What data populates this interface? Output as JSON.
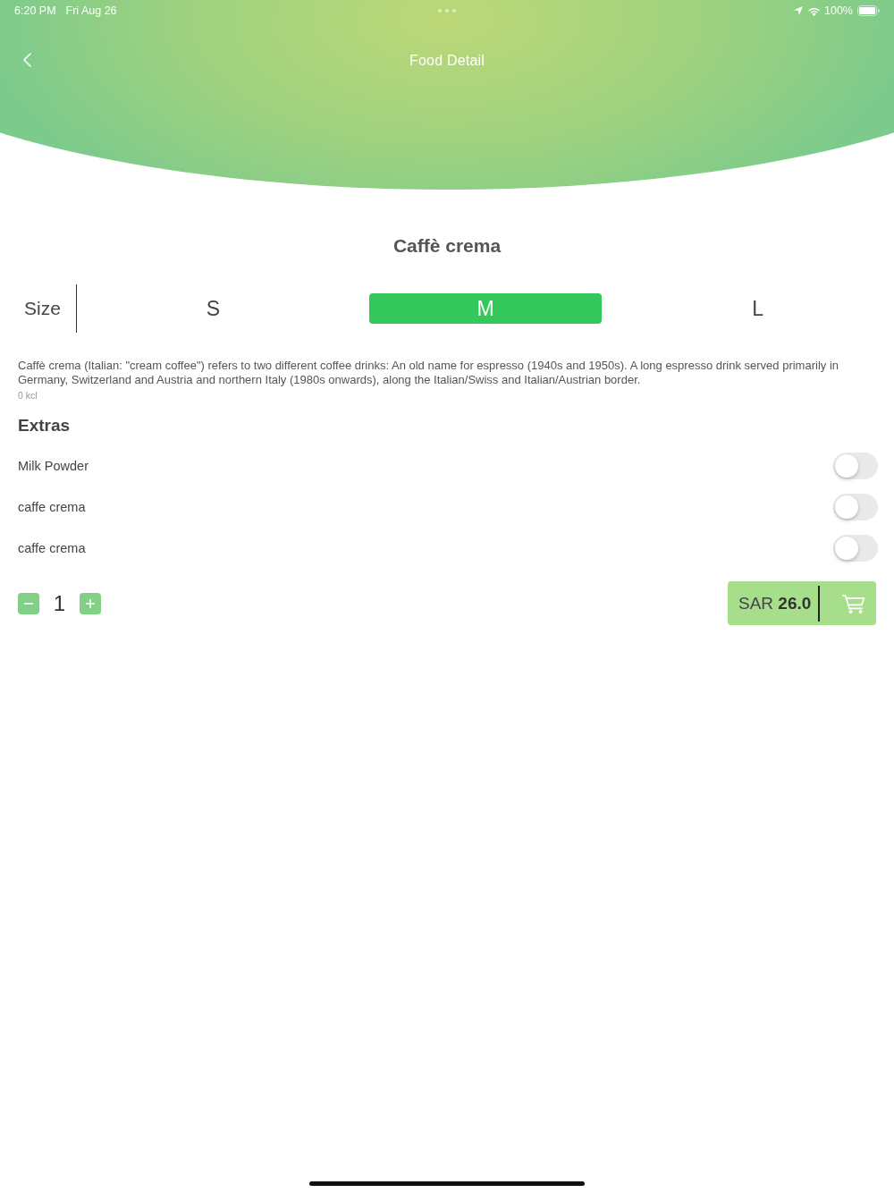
{
  "status_bar": {
    "time": "6:20 PM",
    "date": "Fri Aug 26",
    "battery": "100%"
  },
  "nav": {
    "title": "Food Detail"
  },
  "item": {
    "name": "Caffè crema",
    "description": "Caffè crema (Italian: \"cream coffee\") refers to two different coffee drinks: An old name for espresso (1940s and 1950s). A long espresso drink served primarily in Germany, Switzerland and Austria and northern Italy (1980s onwards), along the Italian/Swiss and Italian/Austrian border.",
    "calories": "0 kcl"
  },
  "size": {
    "label": "Size",
    "options": [
      {
        "label": "S",
        "selected": false
      },
      {
        "label": "M",
        "selected": true
      },
      {
        "label": "L",
        "selected": false
      }
    ]
  },
  "extras": {
    "title": "Extras",
    "items": [
      {
        "name": "Milk Powder",
        "on": false
      },
      {
        "name": "caffe crema",
        "on": false
      },
      {
        "name": "caffe crema",
        "on": false
      }
    ]
  },
  "quantity": {
    "value": "1"
  },
  "cart": {
    "currency": "SAR",
    "price": "26.0"
  }
}
